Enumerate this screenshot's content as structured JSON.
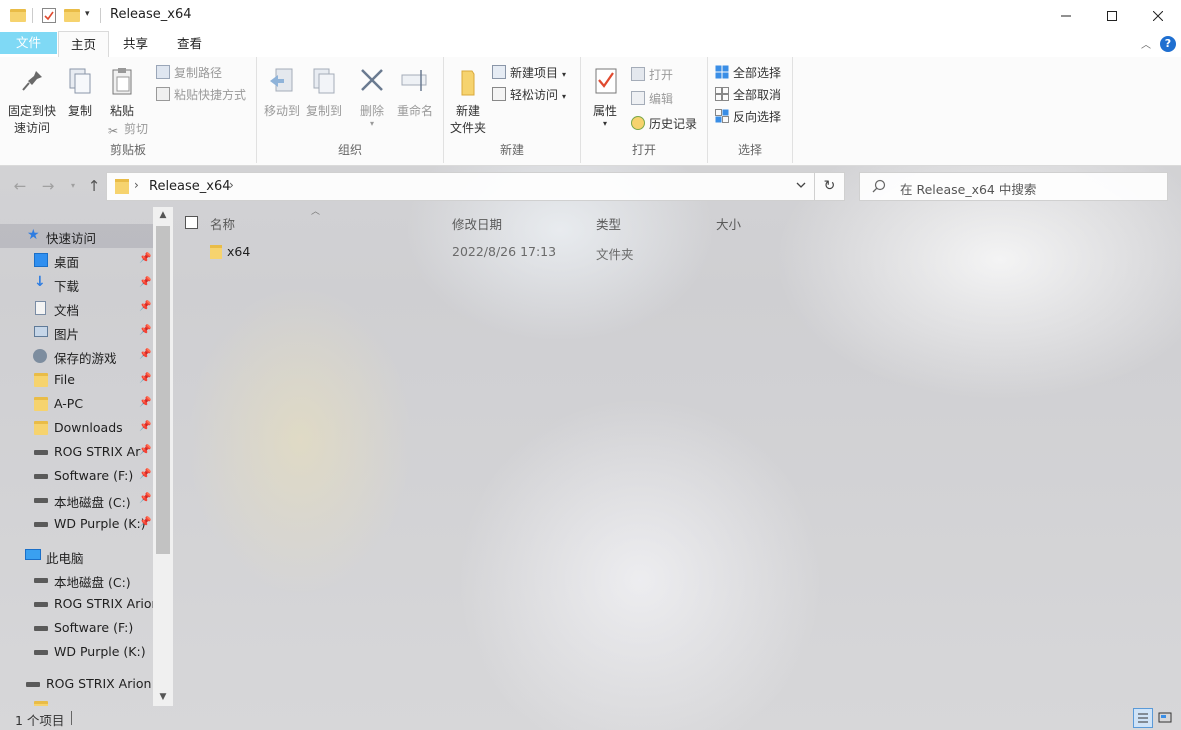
{
  "window": {
    "title": "Release_x64",
    "minimize_icon": "minimize-icon",
    "maximize_icon": "maximize-icon",
    "close_icon": "close-icon"
  },
  "ribbon_tabs": [
    "文件",
    "主页",
    "共享",
    "查看"
  ],
  "ribbon": {
    "clipboard": {
      "label": "剪贴板",
      "pin_quick_access": "固定到快\n速访问",
      "copy": "复制",
      "paste": "粘贴",
      "copy_path": "复制路径",
      "paste_shortcut": "粘贴快捷方式",
      "cut": "剪切"
    },
    "organize": {
      "label": "组织",
      "move_to": "移动到",
      "copy_to": "复制到",
      "delete": "删除",
      "rename": "重命名"
    },
    "new": {
      "label": "新建",
      "new_folder": "新建\n文件夹",
      "new_item": "新建项目",
      "easy_access": "轻松访问"
    },
    "open": {
      "label": "打开",
      "properties": "属性",
      "open": "打开",
      "edit": "编辑",
      "history": "历史记录"
    },
    "select": {
      "label": "选择",
      "select_all": "全部选择",
      "select_none": "全部取消",
      "invert": "反向选择"
    }
  },
  "address": {
    "path": "Release_x64",
    "search_placeholder": "在 Release_x64 中搜索"
  },
  "nav": {
    "quick_access": "快速访问",
    "quick_items": [
      {
        "label": "桌面",
        "icon": "desktop-icon"
      },
      {
        "label": "下载",
        "icon": "download-icon"
      },
      {
        "label": "文档",
        "icon": "document-icon"
      },
      {
        "label": "图片",
        "icon": "picture-icon"
      },
      {
        "label": "保存的游戏",
        "icon": "saved-games-icon"
      },
      {
        "label": "File",
        "icon": "folder-icon"
      },
      {
        "label": "A-PC",
        "icon": "folder-icon"
      },
      {
        "label": "Downloads",
        "icon": "folder-icon"
      },
      {
        "label": "ROG STRIX Ar",
        "icon": "drive-icon"
      },
      {
        "label": "Software (F:)",
        "icon": "drive-icon"
      },
      {
        "label": "本地磁盘 (C:)",
        "icon": "system-drive-icon"
      },
      {
        "label": "WD Purple (K:)",
        "icon": "drive-icon"
      }
    ],
    "this_pc": "此电脑",
    "pc_items": [
      {
        "label": "本地磁盘 (C:)",
        "icon": "system-drive-icon"
      },
      {
        "label": "ROG STRIX Arion",
        "icon": "drive-icon"
      },
      {
        "label": "Software (F:)",
        "icon": "drive-icon"
      },
      {
        "label": "WD Purple (K:)",
        "icon": "drive-icon"
      }
    ],
    "extra_drive": "ROG STRIX Arion ("
  },
  "file_list": {
    "columns": [
      "名称",
      "修改日期",
      "类型",
      "大小"
    ],
    "rows": [
      {
        "name": "x64",
        "modified": "2022/8/26 17:13",
        "type": "文件夹",
        "size": ""
      }
    ]
  },
  "status": {
    "item_count": "1 个项目"
  }
}
